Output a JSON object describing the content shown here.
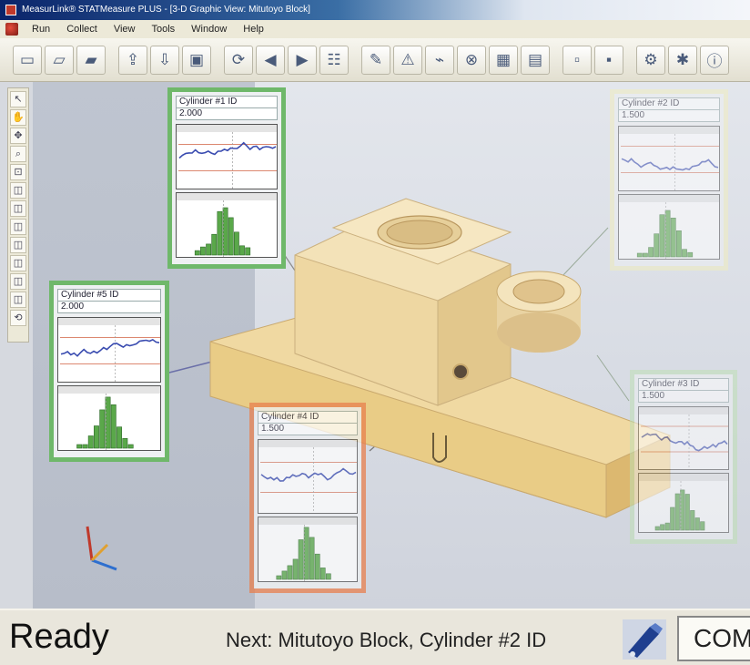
{
  "window": {
    "title": "MeasurLink® STATMeasure PLUS - [3-D Graphic View: Mitutoyo Block]"
  },
  "menu": {
    "items": [
      "Run",
      "Collect",
      "View",
      "Tools",
      "Window",
      "Help"
    ]
  },
  "panels": {
    "cyl1": {
      "title": "Cylinder #1 ID",
      "value": "2.000"
    },
    "cyl2": {
      "title": "Cylinder #2 ID",
      "value": "1.500"
    },
    "cyl3": {
      "title": "Cylinder #3 ID",
      "value": "1.500"
    },
    "cyl4": {
      "title": "Cylinder #4 ID",
      "value": "1.500"
    },
    "cyl5": {
      "title": "Cylinder #5 ID",
      "value": "2.000"
    }
  },
  "colors": {
    "highlight_green": "#6fb86a",
    "highlight_yellow": "#f1eec0",
    "highlight_orange": "#e8804f",
    "trend_line": "#3a4cb0",
    "histogram_bar": "#5aa84a",
    "limit_line": "#d06040"
  },
  "statusbar": {
    "ready": "Ready",
    "next": "Next: Mitutoyo Block, Cylinder #2 ID",
    "com": "COM"
  }
}
